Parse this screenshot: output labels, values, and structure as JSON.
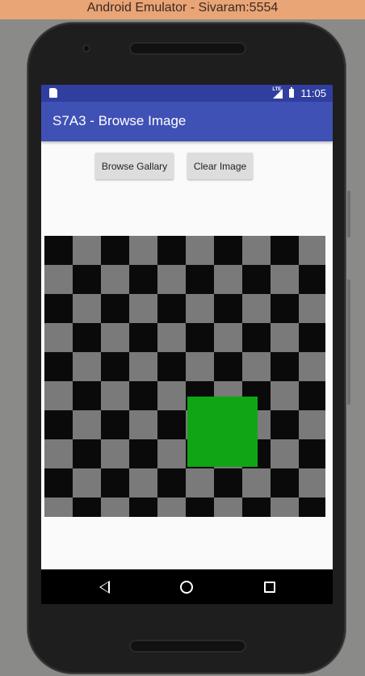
{
  "window": {
    "title": "Android Emulator - Sivaram:5554"
  },
  "status_bar": {
    "time": "11:05",
    "network": "LTE",
    "left_icon": "sd-card-icon",
    "right_icons": [
      "lte-signal-icon",
      "battery-icon"
    ]
  },
  "app_bar": {
    "title": "S7A3 - Browse Image"
  },
  "buttons": {
    "browse_label": "Browse Gallary",
    "clear_label": "Clear Image"
  },
  "image": {
    "pattern": "checkerboard",
    "colors": {
      "dark": "#0a0a0a",
      "light": "#7a7a7a",
      "square": "#10a514"
    }
  },
  "nav_bar": {
    "icons": [
      "back-icon",
      "home-icon",
      "recents-icon"
    ]
  },
  "colors": {
    "status_bar": "#303f9f",
    "app_bar": "#3f51b5",
    "window_title_bar": "#e9a576"
  }
}
